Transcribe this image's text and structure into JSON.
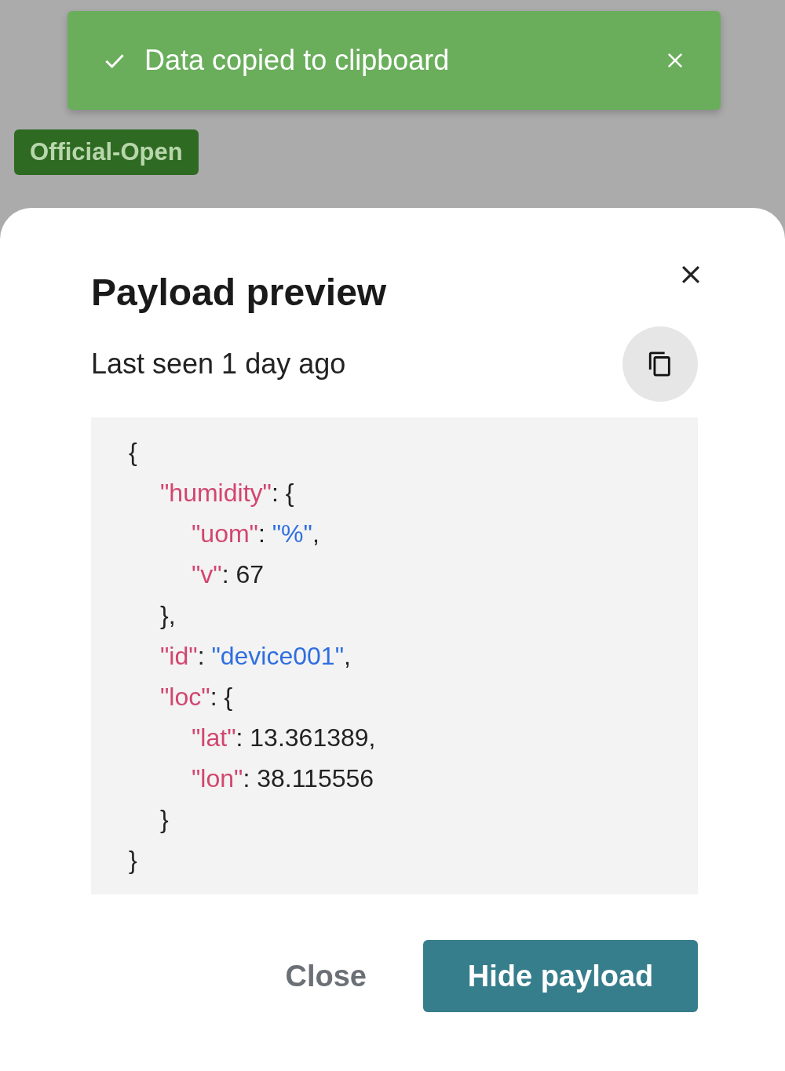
{
  "toast": {
    "message": "Data copied to clipboard",
    "dismissible": true
  },
  "badge": {
    "label": "Official-Open",
    "color": "#2e6a22"
  },
  "modal": {
    "title": "Payload preview",
    "subtitle": "Last seen 1 day ago",
    "code": [
      {
        "tokens": [
          {
            "kind": "punct",
            "text": "{"
          }
        ],
        "children": [
          {
            "tokens": [
              {
                "kind": "key",
                "text": "\"humidity\""
              },
              {
                "kind": "punct",
                "text": ": {"
              }
            ],
            "children": [
              {
                "tokens": [
                  {
                    "kind": "key",
                    "text": "\"uom\""
                  },
                  {
                    "kind": "punct",
                    "text": ": "
                  },
                  {
                    "kind": "string",
                    "text": "\"%\""
                  },
                  {
                    "kind": "punct",
                    "text": ","
                  }
                ]
              },
              {
                "tokens": [
                  {
                    "kind": "key",
                    "text": "\"v\""
                  },
                  {
                    "kind": "punct",
                    "text": ": 67"
                  }
                ]
              }
            ],
            "close": [
              {
                "kind": "punct",
                "text": "},"
              }
            ]
          },
          {
            "tokens": [
              {
                "kind": "key",
                "text": "\"id\""
              },
              {
                "kind": "punct",
                "text": ": "
              },
              {
                "kind": "string",
                "text": "\"device001\""
              },
              {
                "kind": "punct",
                "text": ","
              }
            ]
          },
          {
            "tokens": [
              {
                "kind": "key",
                "text": "\"loc\""
              },
              {
                "kind": "punct",
                "text": ": {"
              }
            ],
            "children": [
              {
                "tokens": [
                  {
                    "kind": "key",
                    "text": "\"lat\""
                  },
                  {
                    "kind": "punct",
                    "text": ": 13.361389,"
                  }
                ]
              },
              {
                "tokens": [
                  {
                    "kind": "key",
                    "text": "\"lon\""
                  },
                  {
                    "kind": "punct",
                    "text": ": 38.115556"
                  }
                ]
              }
            ],
            "close": [
              {
                "kind": "punct",
                "text": "}"
              }
            ]
          }
        ],
        "close": [
          {
            "kind": "punct",
            "text": "}"
          }
        ]
      }
    ],
    "buttons": [
      {
        "label": "Close",
        "kind": "text"
      },
      {
        "label": "Hide payload",
        "kind": "primary"
      }
    ]
  }
}
